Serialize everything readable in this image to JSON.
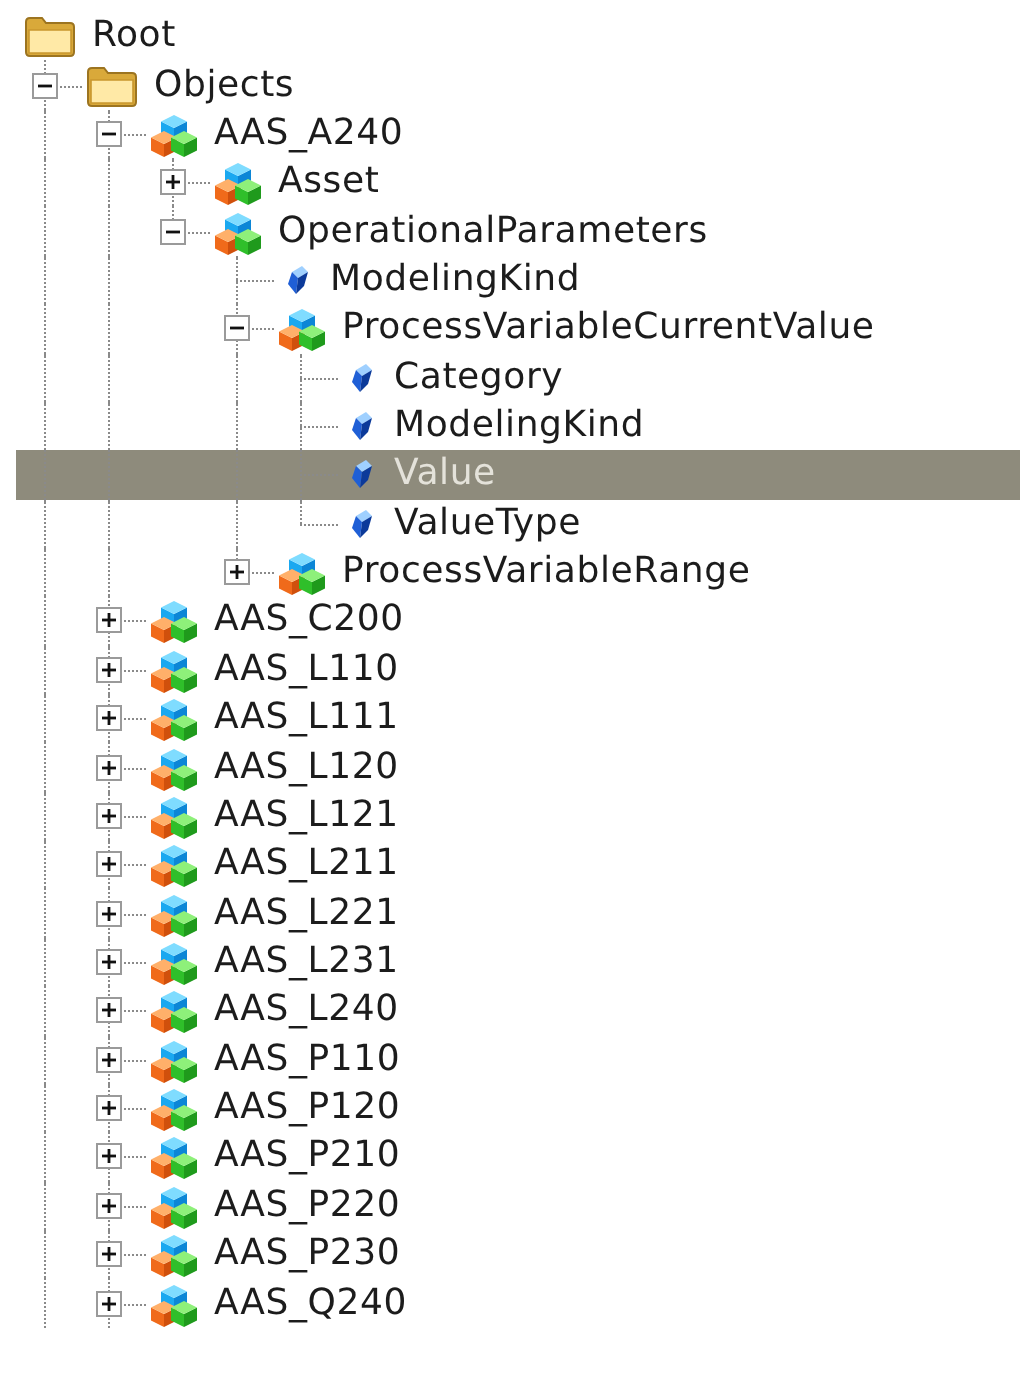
{
  "tree": {
    "continues_below": true,
    "items": [
      {
        "label": "Root",
        "kind": "folder",
        "selected": false,
        "children": [
          {
            "label": "Objects",
            "kind": "folder",
            "expanded": true,
            "selected": false,
            "children": [
              {
                "label": "AAS_A240",
                "kind": "object",
                "expanded": true,
                "selected": false,
                "children": [
                  {
                    "label": "Asset",
                    "kind": "object",
                    "expanded": false,
                    "selected": false
                  },
                  {
                    "label": "OperationalParameters",
                    "kind": "object",
                    "expanded": true,
                    "selected": false,
                    "children": [
                      {
                        "label": "ModelingKind",
                        "kind": "property",
                        "selected": false
                      },
                      {
                        "label": "ProcessVariableCurrentValue",
                        "kind": "object",
                        "expanded": true,
                        "selected": false,
                        "children": [
                          {
                            "label": "Category",
                            "kind": "property",
                            "selected": false
                          },
                          {
                            "label": "ModelingKind",
                            "kind": "property",
                            "selected": false
                          },
                          {
                            "label": "Value",
                            "kind": "property",
                            "selected": true
                          },
                          {
                            "label": "ValueType",
                            "kind": "property",
                            "selected": false
                          }
                        ]
                      },
                      {
                        "label": "ProcessVariableRange",
                        "kind": "object",
                        "expanded": false,
                        "selected": false
                      }
                    ]
                  }
                ]
              },
              {
                "label": "AAS_C200",
                "kind": "object",
                "expanded": false,
                "selected": false
              },
              {
                "label": "AAS_L110",
                "kind": "object",
                "expanded": false,
                "selected": false
              },
              {
                "label": "AAS_L111",
                "kind": "object",
                "expanded": false,
                "selected": false
              },
              {
                "label": "AAS_L120",
                "kind": "object",
                "expanded": false,
                "selected": false
              },
              {
                "label": "AAS_L121",
                "kind": "object",
                "expanded": false,
                "selected": false
              },
              {
                "label": "AAS_L211",
                "kind": "object",
                "expanded": false,
                "selected": false
              },
              {
                "label": "AAS_L221",
                "kind": "object",
                "expanded": false,
                "selected": false
              },
              {
                "label": "AAS_L231",
                "kind": "object",
                "expanded": false,
                "selected": false
              },
              {
                "label": "AAS_L240",
                "kind": "object",
                "expanded": false,
                "selected": false
              },
              {
                "label": "AAS_P110",
                "kind": "object",
                "expanded": false,
                "selected": false
              },
              {
                "label": "AAS_P120",
                "kind": "object",
                "expanded": false,
                "selected": false
              },
              {
                "label": "AAS_P210",
                "kind": "object",
                "expanded": false,
                "selected": false
              },
              {
                "label": "AAS_P220",
                "kind": "object",
                "expanded": false,
                "selected": false
              },
              {
                "label": "AAS_P230",
                "kind": "object",
                "expanded": false,
                "selected": false
              },
              {
                "label": "AAS_Q240",
                "kind": "object",
                "expanded": false,
                "selected": false
              }
            ]
          }
        ]
      }
    ]
  }
}
